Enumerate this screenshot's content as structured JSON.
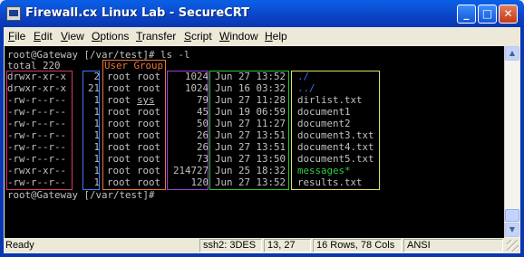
{
  "window": {
    "title": "Firewall.cx Linux Lab - SecureCRT",
    "minimize_glyph": "_",
    "maximize_glyph": "□",
    "close_glyph": "✕"
  },
  "menu": [
    "File",
    "Edit",
    "View",
    "Options",
    "Transfer",
    "Script",
    "Window",
    "Help"
  ],
  "terminal": {
    "prompt_cmd": "root@Gateway [/var/test]# ls -l",
    "total": "total 220",
    "user_group_label": "User Group",
    "rows": [
      {
        "perm": "drwxr-xr-x",
        "links": "2",
        "user": "root",
        "group": "root",
        "size": "1024",
        "date": "Jun 27 13:52",
        "name": "./"
      },
      {
        "perm": "drwxr-xr-x",
        "links": "21",
        "user": "root",
        "group": "root",
        "size": "1024",
        "date": "Jun 16 03:32",
        "name": "../"
      },
      {
        "perm": "-rw-r--r--",
        "links": "1",
        "user": "root",
        "group": "sys",
        "size": "79",
        "date": "Jun 27 11:28",
        "name": "dirlist.txt"
      },
      {
        "perm": "-rw-r--r--",
        "links": "1",
        "user": "root",
        "group": "root",
        "size": "45",
        "date": "Jun 19 06:59",
        "name": "document1"
      },
      {
        "perm": "-rw-r--r--",
        "links": "1",
        "user": "root",
        "group": "root",
        "size": "50",
        "date": "Jun 27 11:27",
        "name": "document2"
      },
      {
        "perm": "-rw-r--r--",
        "links": "1",
        "user": "root",
        "group": "root",
        "size": "26",
        "date": "Jun 27 13:51",
        "name": "document3.txt"
      },
      {
        "perm": "-rw-r--r--",
        "links": "1",
        "user": "root",
        "group": "root",
        "size": "26",
        "date": "Jun 27 13:51",
        "name": "document4.txt"
      },
      {
        "perm": "-rw-r--r--",
        "links": "1",
        "user": "root",
        "group": "root",
        "size": "73",
        "date": "Jun 27 13:50",
        "name": "document5.txt"
      },
      {
        "perm": "-rwxr-xr--",
        "links": "1",
        "user": "root",
        "group": "root",
        "size": "214727",
        "date": "Jun 25 18:32",
        "name": "messages*"
      },
      {
        "perm": "-rw-r--r--",
        "links": "1",
        "user": "root",
        "group": "root",
        "size": "120",
        "date": "Jun 27 13:52",
        "name": "results.txt"
      }
    ],
    "prompt_end": "root@Gateway [/var/test]#"
  },
  "statusbar": {
    "ready": "Ready",
    "cipher": "ssh2: 3DES",
    "cursor": "13, 27",
    "dims": "16 Rows, 78 Cols",
    "encoding": "ANSI"
  },
  "colors": {
    "text": "#c0c0c0",
    "dir": "#4a6cff",
    "exec": "#2ecc40",
    "box_perm": "#d6367a",
    "box_links": "#3f7cff",
    "box_owner": "#e8763a",
    "box_size": "#9b3fd6",
    "box_date": "#31c531",
    "box_name": "#e0e060",
    "user_group_label": "#e8763a"
  }
}
